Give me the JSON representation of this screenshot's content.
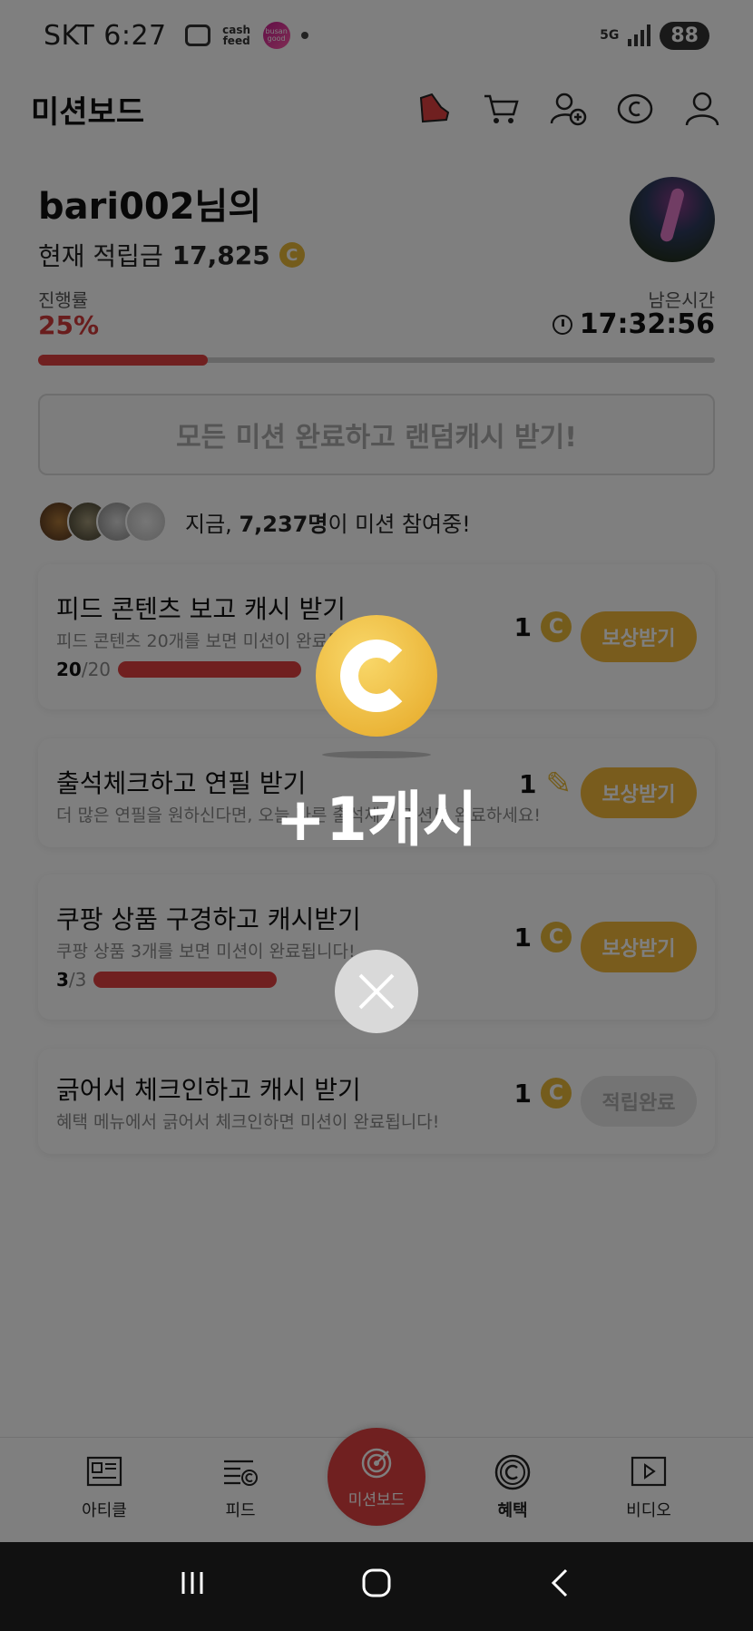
{
  "status_bar": {
    "carrier_time": "SKT 6:27",
    "cash_feed": "cash feed",
    "busan_good": "busan good",
    "network": "5G",
    "battery": "88"
  },
  "header": {
    "title": "미션보드",
    "icons": [
      "shoe-icon",
      "cart-icon",
      "add-user-icon",
      "coin-icon",
      "profile-icon"
    ]
  },
  "profile": {
    "username": "bari002님의",
    "balance_label": "현재 적립금",
    "balance_value": "17,825",
    "coin_symbol": "C"
  },
  "progress": {
    "label": "진행률",
    "value": "25%",
    "fraction": 0.25,
    "remaining_label": "남은시간",
    "remaining_value": "17:32:56"
  },
  "all_mission_banner": "모든 미션 완료하고 랜덤캐시 받기!",
  "participants": {
    "prefix": "지금,",
    "count": "7,237명",
    "suffix": "이 미션 참여중!"
  },
  "missions": [
    {
      "title": "피드 콘텐츠 보고 캐시 받기",
      "desc": "피드 콘텐츠 20개를 보면 미션이 완료됩니다!",
      "done": "20",
      "total": "/20",
      "progress": 1.0,
      "reward": "1",
      "reward_icon": "coin-icon",
      "button": "보상받기"
    },
    {
      "title": "출석체크하고 연필 받기",
      "desc": "더 많은 연필을 원하신다면, 오늘 다른 출석체크 미션도 완료하세요!",
      "reward": "1",
      "reward_icon": "pencil-icon",
      "button": "보상받기"
    },
    {
      "title": "쿠팡 상품 구경하고 캐시받기",
      "desc": "쿠팡 상품 3개를 보면 미션이 완료됩니다!",
      "done": "3",
      "total": "/3",
      "progress": 1.0,
      "reward": "1",
      "reward_icon": "coin-icon",
      "button": "보상받기"
    },
    {
      "title": "긁어서 체크인하고 캐시 받기",
      "desc": "혜택 메뉴에서 긁어서 체크인하면 미션이 완료됩니다!",
      "reward": "1",
      "reward_icon": "coin-icon",
      "button": "적립완료"
    }
  ],
  "bottom_nav": {
    "article": "아티클",
    "feed": "피드",
    "mission": "미션보드",
    "benefit": "혜택",
    "video": "비디오"
  },
  "overlay": {
    "cash_text": "+1캐시"
  },
  "colors": {
    "accent_red": "#e04040",
    "coin_gold": "#e8b938",
    "button_gold": "#f3b83a"
  }
}
